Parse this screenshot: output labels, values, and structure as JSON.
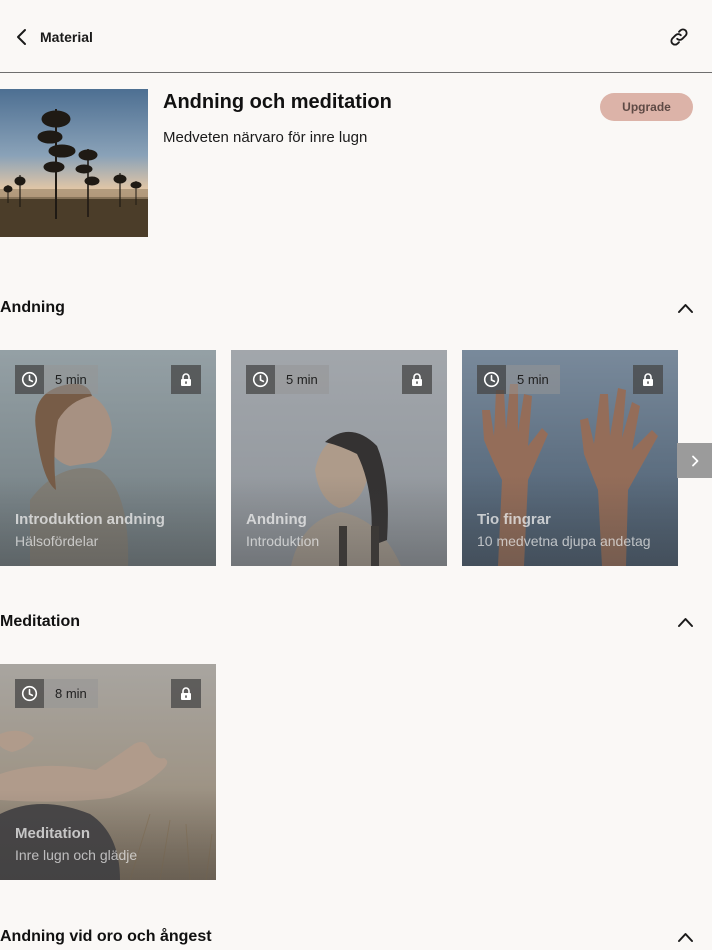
{
  "topbar": {
    "back_label": "Material",
    "back_icon": "chevron-left-icon",
    "link_icon": "link-icon"
  },
  "header": {
    "title": "Andning och meditation",
    "subtitle": "Medveten närvaro för inre lugn",
    "upgrade_label": "Upgrade"
  },
  "colors": {
    "background": "#faf8f6",
    "upgrade_bg": "#dcb3a8",
    "upgrade_text": "#5e4a45",
    "divider": "#6e6e6e"
  },
  "sections": [
    {
      "title": "Andning",
      "cards": [
        {
          "title": "Introduktion andning",
          "subtitle": "Hälsofördelar",
          "duration": "5 min"
        },
        {
          "title": "Andning",
          "subtitle": "Introduktion",
          "duration": "5 min"
        },
        {
          "title": "Tio fingrar",
          "subtitle": "10 medvetna djupa andetag",
          "duration": "5 min"
        }
      ]
    },
    {
      "title": "Meditation",
      "cards": [
        {
          "title": "Meditation",
          "subtitle": "Inre lugn och glädje",
          "duration": "8 min"
        }
      ]
    },
    {
      "title": "Andning vid oro och ångest",
      "cards": []
    }
  ]
}
